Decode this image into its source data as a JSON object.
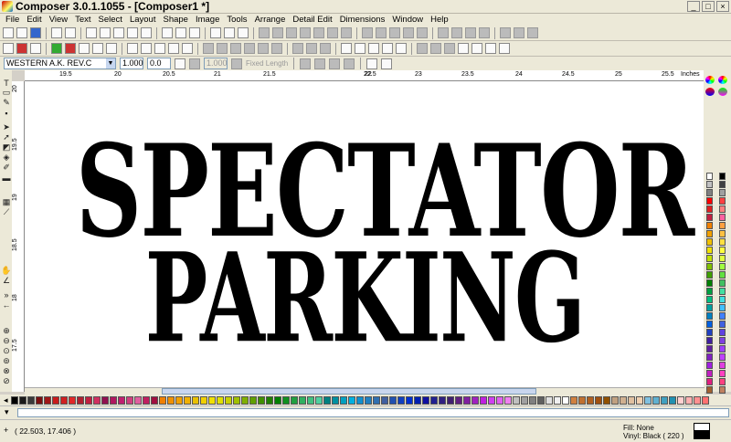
{
  "window": {
    "title": "Composer 3.0.1.1055 - [Composer1 *]",
    "controls": [
      "_",
      "□",
      "×"
    ]
  },
  "menu": [
    "File",
    "Edit",
    "View",
    "Text",
    "Select",
    "Layout",
    "Shape",
    "Image",
    "Tools",
    "Arrange",
    "Detail Edit",
    "Dimensions",
    "Window",
    "Help"
  ],
  "properties": {
    "font_name": "WESTERN A.K. REV.C",
    "scale_x": "1.000",
    "angle": "0.0",
    "fixed_value": "1.000",
    "fixed_length_label": "Fixed Length"
  },
  "ruler": {
    "units": "Inches",
    "h_ticks": [
      "19.5",
      "20",
      "20.5",
      "21",
      "21.5",
      "22",
      "22.5",
      "23",
      "23.5",
      "24",
      "24.5",
      "25",
      "25.5"
    ],
    "v_ticks": [
      "20",
      "19.5",
      "19",
      "18.5",
      "18",
      "17.5"
    ]
  },
  "design": {
    "line1": "SPECTATOR",
    "line2": "PARKING"
  },
  "status": {
    "coords": "( 22.503, 17.406 )",
    "fill": "Fill: None",
    "vinyl": "Vinyl: Black ( 220 )"
  },
  "colors": {
    "palette": [
      "#000000",
      "#1a1a1a",
      "#3a3a3a",
      "#7a1010",
      "#a01818",
      "#c81c1c",
      "#d02020",
      "#e02828",
      "#b02030",
      "#c02040",
      "#d03060",
      "#901050",
      "#b01860",
      "#c02070",
      "#d04080",
      "#e060a0",
      "#c02060",
      "#a01040",
      "#f08000",
      "#f09000",
      "#f0a000",
      "#f0b000",
      "#e8c000",
      "#f0d000",
      "#f0e000",
      "#e0e000",
      "#c8d000",
      "#a0c000",
      "#80b000",
      "#60a000",
      "#409000",
      "#208000",
      "#008000",
      "#109020",
      "#20a040",
      "#30b060",
      "#40c080",
      "#50d0a0",
      "#008080",
      "#0090a0",
      "#00a0c0",
      "#00b0e0",
      "#1090d0",
      "#2080c0",
      "#3070b0",
      "#4060a0",
      "#2050b0",
      "#1040c0",
      "#0030d0",
      "#0020b0",
      "#1010a0",
      "#202090",
      "#302080",
      "#402070",
      "#602080",
      "#8020a0",
      "#a020c0",
      "#c020e0",
      "#d040f0",
      "#e060f0",
      "#f080f0",
      "#c0c0c0",
      "#a0a0a0",
      "#808080",
      "#606060",
      "#e0e0e0",
      "#f0f0f0",
      "#ffffff",
      "#d08040",
      "#c07030",
      "#b06020",
      "#a05010",
      "#905000",
      "#c0a080",
      "#d0b090",
      "#e0c0a0",
      "#f0d0b0",
      "#80c0e0",
      "#60b0d0",
      "#40a0c0",
      "#2090b0",
      "#ffd0d0",
      "#ffb0b0",
      "#ff9090",
      "#ff7070"
    ],
    "palette_right_a": [
      "#ffffff",
      "#c0c0c0",
      "#808080",
      "#ff0000",
      "#e02020",
      "#c02040",
      "#f08000",
      "#f0a000",
      "#f0c000",
      "#f0e000",
      "#c0e000",
      "#80c000",
      "#40a000",
      "#008000",
      "#00a040",
      "#00c080",
      "#00a0a0",
      "#0080c0",
      "#0060e0",
      "#2040c0",
      "#4020a0",
      "#6020a0",
      "#8020c0",
      "#a020e0",
      "#c020c0",
      "#e02080",
      "#a06030",
      "#c08050",
      "#e0b070",
      "#404040",
      "#606060",
      "#000000"
    ],
    "palette_right_b": [
      "#000000",
      "#404040",
      "#a0a0a0",
      "#ff4040",
      "#ff8080",
      "#ff60a0",
      "#ffa040",
      "#ffc040",
      "#ffe040",
      "#ffff40",
      "#e0ff40",
      "#a0ff40",
      "#60e040",
      "#40c060",
      "#40e0a0",
      "#40e0e0",
      "#40c0ff",
      "#4080ff",
      "#4060e0",
      "#6040e0",
      "#8040e0",
      "#a040ff",
      "#c040ff",
      "#e040e0",
      "#ff40c0",
      "#ff4080",
      "#c08060",
      "#e0a080",
      "#f0d0a0",
      "#e0e0e0",
      "#ffffff",
      "#202020"
    ]
  }
}
